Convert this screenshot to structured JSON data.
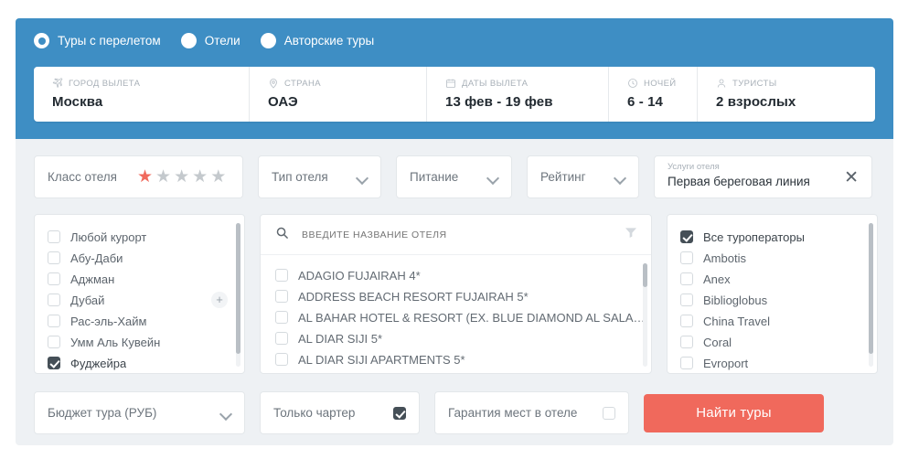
{
  "theme": {
    "header_blue": "#3e8ec4",
    "panel_bg": "#eef1f4",
    "accent_red": "#f0695c",
    "star_active": "#f06a5d",
    "star_inactive": "#c4c9cd",
    "checkbox_checked": "#454f57"
  },
  "tour_type": {
    "options": [
      {
        "label": "Туры с перелетом",
        "selected": true
      },
      {
        "label": "Отели",
        "selected": false
      },
      {
        "label": "Авторские туры",
        "selected": false
      }
    ]
  },
  "search_strip": {
    "fields": [
      {
        "icon": "plane-icon",
        "caption": "ГОРОД ВЫЛЕТА",
        "value": "Москва"
      },
      {
        "icon": "location-pin-icon",
        "caption": "СТРАНА",
        "value": "ОАЭ"
      },
      {
        "icon": "calendar-icon",
        "caption": "ДАТЫ ВЫЛЕТА",
        "value": "13 фев - 19 фев"
      },
      {
        "icon": "clock-icon",
        "caption": "НОЧЕЙ",
        "value": "6 - 14"
      },
      {
        "icon": "person-icon",
        "caption": "ТУРИСТЫ",
        "value": "2 взрослых"
      }
    ]
  },
  "filters_row": {
    "hotel_class": {
      "label": "Класс отеля",
      "stars_total": 5,
      "stars_active": 1
    },
    "hotel_type": {
      "label": "Тип отеля"
    },
    "meals": {
      "label": "Питание"
    },
    "rating": {
      "label": "Рейтинг"
    },
    "services": {
      "caption": "Услуги отеля",
      "value": "Первая береговая линия",
      "clear_icon": "close-icon"
    }
  },
  "resorts": {
    "items": [
      {
        "label": "Любой курорт",
        "checked": false
      },
      {
        "label": "Абу-Даби",
        "checked": false
      },
      {
        "label": "Аджман",
        "checked": false
      },
      {
        "label": "Дубай",
        "checked": false,
        "has_plus": true
      },
      {
        "label": "Рас-эль-Хайм",
        "checked": false
      },
      {
        "label": "Умм Аль Кувейн",
        "checked": false
      },
      {
        "label": "Фуджейра",
        "checked": true
      }
    ],
    "plus_label": "+"
  },
  "hotels": {
    "search_placeholder": "ВВЕДИТЕ НАЗВАНИЕ ОТЕЛЯ",
    "search_value": "",
    "search_icon": "search-icon",
    "filter_icon": "funnel-icon",
    "items": [
      {
        "label": "ADAGIO FUJAIRAH 4*",
        "checked": false
      },
      {
        "label": "ADDRESS BEACH RESORT FUJAIRAH 5*",
        "checked": false
      },
      {
        "label": "AL BAHAR HOTEL & RESORT (EX. BLUE DIAMOND AL SALAM ...",
        "checked": false
      },
      {
        "label": "AL DIAR SIJI 5*",
        "checked": false
      },
      {
        "label": "AL DIAR SIJI APARTMENTS 5*",
        "checked": false
      }
    ]
  },
  "operators": {
    "items": [
      {
        "label": "Все туроператоры",
        "checked": true
      },
      {
        "label": "Ambotis",
        "checked": false
      },
      {
        "label": "Anex",
        "checked": false
      },
      {
        "label": "Biblioglobus",
        "checked": false
      },
      {
        "label": "China Travel",
        "checked": false
      },
      {
        "label": "Coral",
        "checked": false
      },
      {
        "label": "Evroport",
        "checked": false
      }
    ]
  },
  "bottom_row": {
    "budget": {
      "label": "Бюджет тура (РУБ)"
    },
    "charter_only": {
      "label": "Только чартер",
      "checked": true
    },
    "room_guarantee": {
      "label": "Гарантия мест в отеле",
      "checked": false
    },
    "find_button": "Найти туры"
  }
}
